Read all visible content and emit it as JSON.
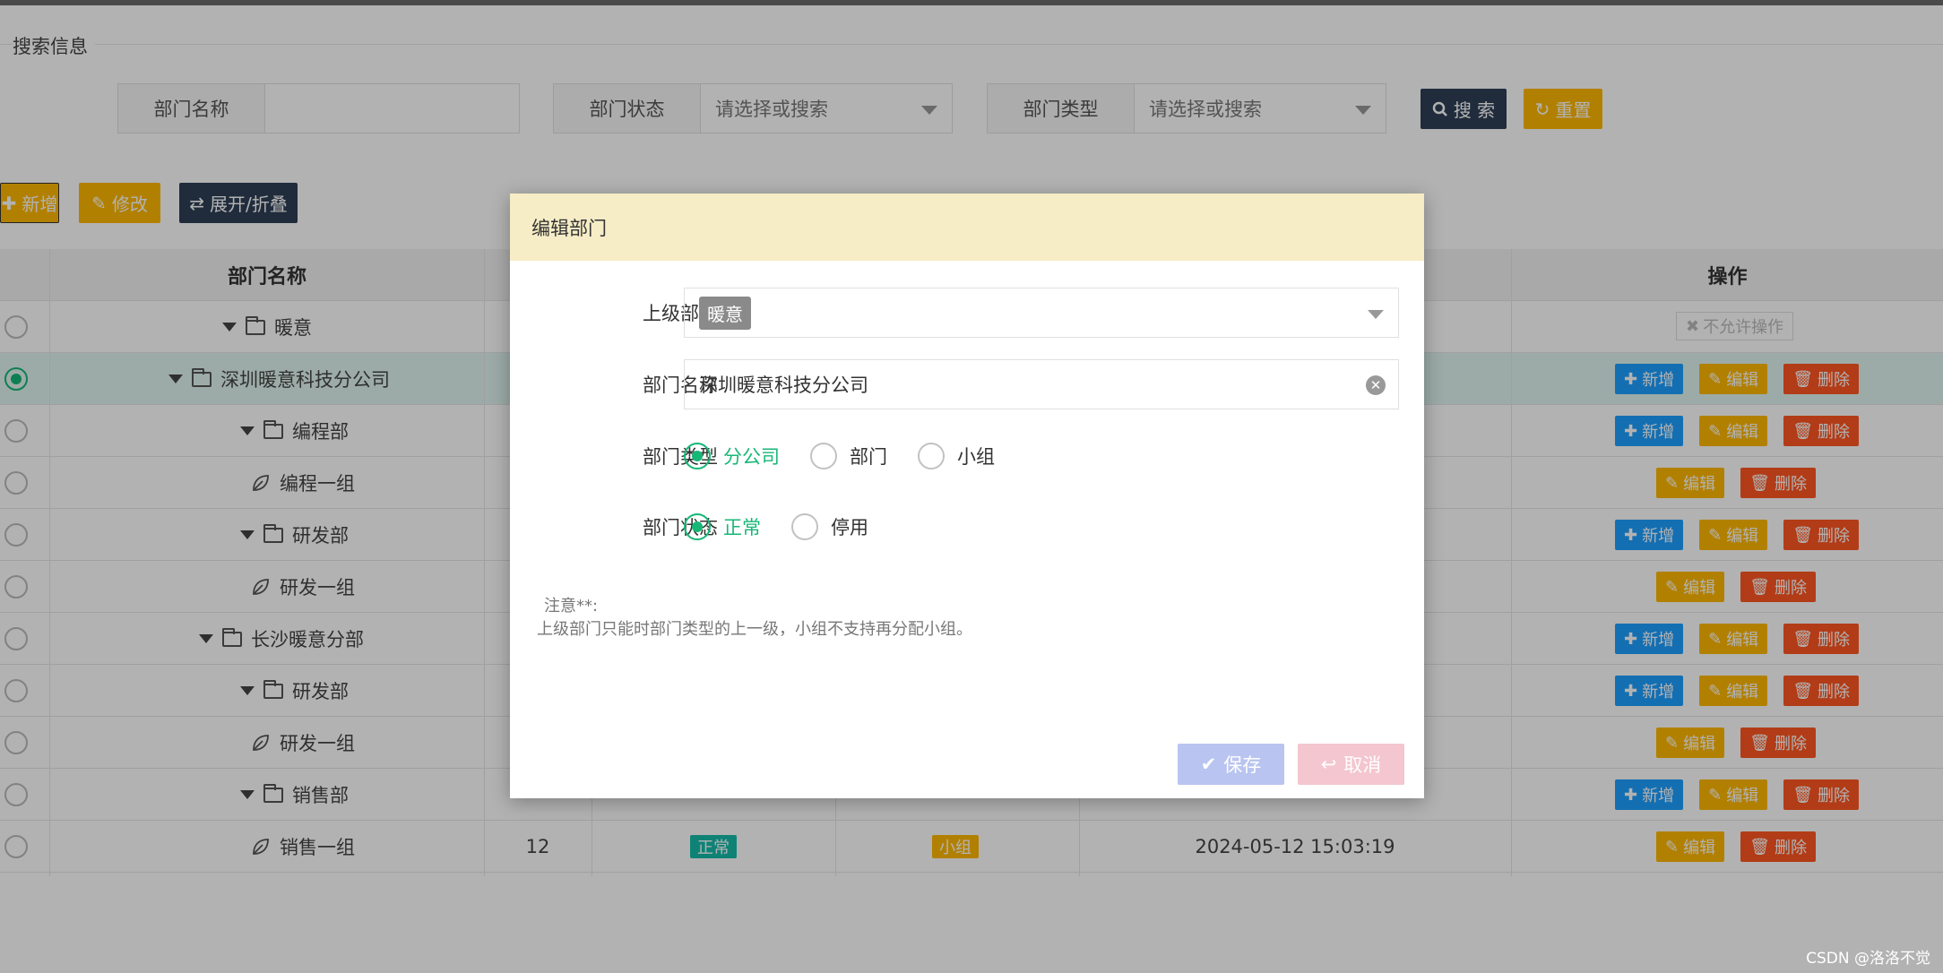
{
  "search": {
    "legend": "搜索信息",
    "dept_name_label": "部门名称",
    "dept_name_value": "",
    "dept_status_label": "部门状态",
    "dept_status_placeholder": "请选择或搜索",
    "dept_type_label": "部门类型",
    "dept_type_placeholder": "请选择或搜索",
    "search_button": "搜 索",
    "reset_button": "重置"
  },
  "toolbar": {
    "add": "新增",
    "edit": "修改",
    "toggle": "展开/折叠"
  },
  "table": {
    "headers": {
      "name": "部门名称",
      "ops": "操作"
    },
    "no_op_label": "不允许操作",
    "add_label": "新增",
    "edit_label": "编辑",
    "delete_label": "删除",
    "rows": [
      {
        "name": "暖意",
        "kind": "folder",
        "ops": "none"
      },
      {
        "name": "深圳暖意科技分公司",
        "kind": "folder",
        "ops": "full"
      },
      {
        "name": "编程部",
        "kind": "folder",
        "ops": "full"
      },
      {
        "name": "编程一组",
        "kind": "leaf",
        "ops": "edit"
      },
      {
        "name": "研发部",
        "kind": "folder",
        "ops": "full"
      },
      {
        "name": "研发一组",
        "kind": "leaf",
        "ops": "edit"
      },
      {
        "name": "长沙暖意分部",
        "kind": "folder",
        "ops": "full"
      },
      {
        "name": "研发部",
        "kind": "folder",
        "ops": "full"
      },
      {
        "name": "研发一组",
        "kind": "leaf",
        "ops": "edit"
      },
      {
        "name": "销售部",
        "kind": "folder",
        "ops": "full"
      },
      {
        "name": "销售一组",
        "kind": "leaf",
        "ops": "edit",
        "order": "12",
        "status": "正常",
        "type": "小组",
        "time": "2024-05-12 15:03:19"
      }
    ]
  },
  "dialog": {
    "title": "编辑部门",
    "parent_label": "上级部门",
    "parent_value": "暖意",
    "name_label": "部门名称",
    "name_value": "深圳暖意科技分公司",
    "type_label": "部门类型",
    "type_options": [
      "分公司",
      "部门",
      "小组"
    ],
    "type_selected": "分公司",
    "status_label": "部门状态",
    "status_options": [
      "正常",
      "停用"
    ],
    "status_selected": "正常",
    "note_title": "注意**:",
    "note_text": "上级部门只能时部门类型的上一级，小组不支持再分配小组。",
    "save": "保存",
    "cancel": "取消"
  },
  "watermark": "CSDN @洛洛不觉",
  "colors": {
    "accent_green": "#16b777",
    "blue": "#1e9fff",
    "orange": "#ffb800",
    "red": "#ff5722",
    "dark": "#2f4056"
  }
}
